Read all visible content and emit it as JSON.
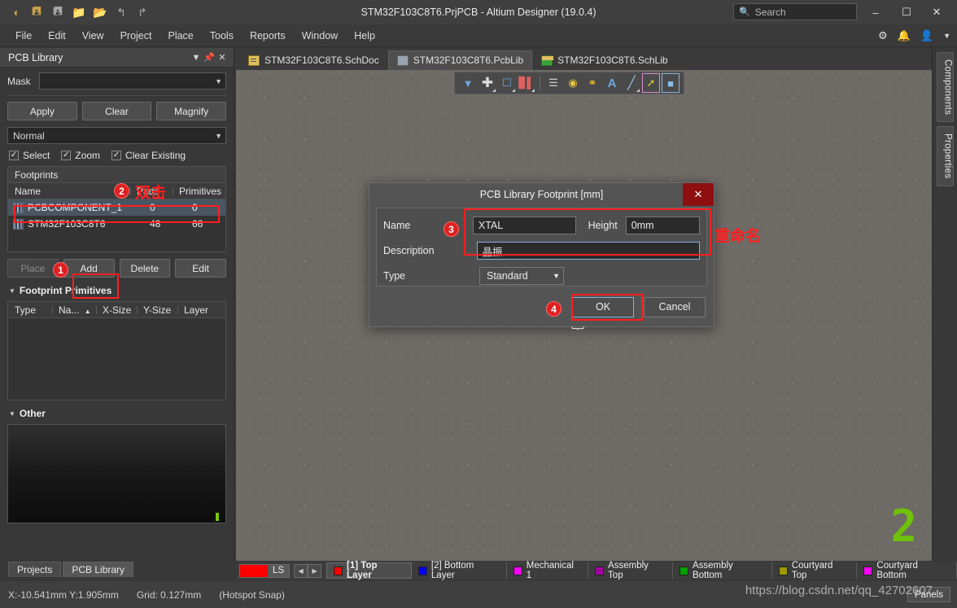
{
  "titlebar": {
    "title": "STM32F103C8T6.PrjPCB - Altium Designer (19.0.4)",
    "quick_icons": [
      "altium-logo-icon",
      "save-icon",
      "save-all-icon",
      "open-icon",
      "open-project-icon",
      "undo-icon",
      "redo-icon"
    ],
    "search_placeholder": "Search",
    "minimize": "–",
    "maximize": "☐",
    "close": "✕"
  },
  "menubar": {
    "items": [
      {
        "label": "File"
      },
      {
        "label": "Edit"
      },
      {
        "label": "View"
      },
      {
        "label": "Project"
      },
      {
        "label": "Place"
      },
      {
        "label": "Tools"
      },
      {
        "label": "Reports"
      },
      {
        "label": "Window"
      },
      {
        "label": "Help"
      }
    ],
    "right_icons": [
      "gear-icon",
      "bell-icon",
      "account-icon",
      "chevron-down-icon"
    ]
  },
  "panel": {
    "title": "PCB Library",
    "header_buttons": [
      "chevron-down-icon",
      "pin-icon",
      "close-icon"
    ],
    "mask_label": "Mask",
    "mask_value": "",
    "buttons": {
      "apply": "Apply",
      "clear": "Clear",
      "magnify": "Magnify"
    },
    "mode_value": "Normal",
    "checks": [
      {
        "label": "Select",
        "checked": true
      },
      {
        "label": "Zoom",
        "checked": true
      },
      {
        "label": "Clear Existing",
        "checked": true
      }
    ],
    "footprints": {
      "caption": "Footprints",
      "columns": [
        "Name",
        "Pads",
        "Primitives"
      ],
      "rows": [
        {
          "name": "PCBCOMPONENT_1",
          "pads": "0",
          "primitives": "0",
          "selected": true
        },
        {
          "name": "STM32F103C8T6",
          "pads": "48",
          "primitives": "66",
          "selected": false
        }
      ]
    },
    "row_buttons": {
      "place": "Place",
      "add": "Add",
      "delete": "Delete",
      "edit": "Edit"
    },
    "primitives": {
      "title": "Footprint Primitives",
      "columns": [
        "Type",
        "Na...",
        "X-Size",
        "Y-Size",
        "Layer"
      ],
      "rows": []
    },
    "other": {
      "title": "Other"
    },
    "tabs": [
      {
        "label": "Projects",
        "active": false
      },
      {
        "label": "PCB Library",
        "active": true
      }
    ]
  },
  "doctabs": [
    {
      "label": "STM32F103C8T6.SchDoc",
      "icon": "schematic-doc-icon",
      "active": false
    },
    {
      "label": "STM32F103C8T6.PcbLib",
      "icon": "pcb-library-icon",
      "active": true
    },
    {
      "label": "STM32F103C8T6.SchLib",
      "icon": "schematic-library-icon",
      "active": false
    }
  ],
  "canvas": {
    "toolbar_icons": [
      "filter-icon",
      "crosshair-place-icon",
      "selection-rect-icon",
      "dimension-icon",
      "component-body-icon",
      "pad-icon",
      "via-icon",
      "text-icon",
      "line-icon",
      "measure-icon",
      "polygon-icon"
    ],
    "green_marker": "2"
  },
  "rightbar": {
    "tabs": [
      {
        "label": "Components"
      },
      {
        "label": "Properties"
      }
    ]
  },
  "dialog": {
    "title": "PCB Library Footprint [mm]",
    "close": "✕",
    "fields": {
      "name_label": "Name",
      "name_value": "XTAL",
      "height_label": "Height",
      "height_value": "0mm",
      "description_label": "Description",
      "description_value": "晶振",
      "type_label": "Type",
      "type_value": "Standard"
    },
    "ok": "OK",
    "cancel": "Cancel"
  },
  "layerbar": {
    "current_swatch_label": "LS",
    "current_swatch_color": "#ff0000",
    "nav_prev": "◀",
    "nav_next": "▶",
    "layers": [
      {
        "label": "[1] Top Layer",
        "color": "#ff0000",
        "active": true
      },
      {
        "label": "[2] Bottom Layer",
        "color": "#0000ff",
        "active": false
      },
      {
        "label": "Mechanical 1",
        "color": "#ff00ff",
        "active": false
      },
      {
        "label": "Assembly Top",
        "color": "#a000a0",
        "active": false
      },
      {
        "label": "Assembly Bottom",
        "color": "#00a000",
        "active": false
      },
      {
        "label": "Courtyard Top",
        "color": "#9a9a00",
        "active": false
      },
      {
        "label": "Courtyard Bottom",
        "color": "#ff00ff",
        "active": false
      }
    ]
  },
  "statusbar": {
    "coords": "X:-10.541mm Y:1.905mm",
    "grid": "Grid: 0.127mm",
    "snap": "(Hotspot Snap)",
    "panels_button": "Panels",
    "watermark": "https://blog.csdn.net/qq_42702607"
  },
  "annotations": {
    "step1": "1",
    "step2": "2",
    "step3": "3",
    "step4": "4",
    "note_double_click": "双击",
    "note_rename": "重命名"
  }
}
